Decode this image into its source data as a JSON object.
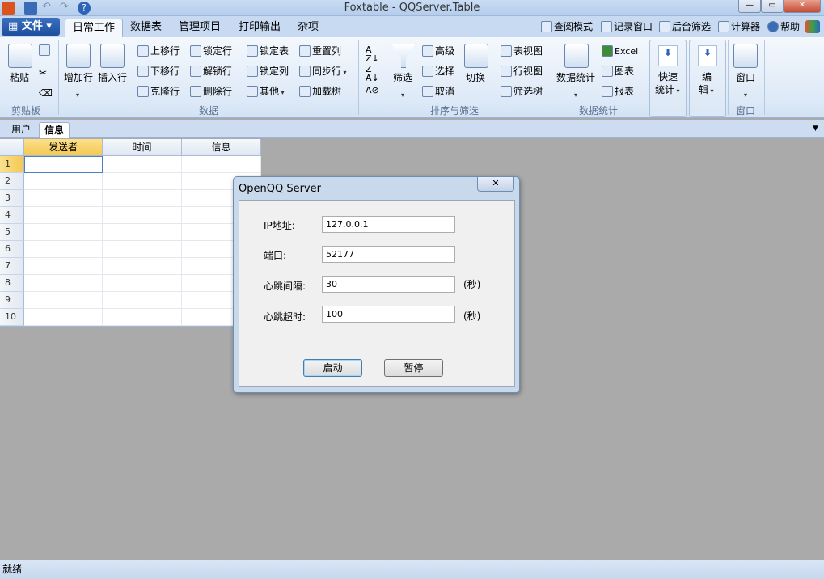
{
  "window": {
    "title": "Foxtable - QQServer.Table"
  },
  "menu": {
    "file": "文件",
    "tabs": [
      "日常工作",
      "数据表",
      "管理项目",
      "打印输出",
      "杂项"
    ]
  },
  "right_tools": [
    "查阅模式",
    "记录窗口",
    "后台筛选",
    "计算器",
    "帮助"
  ],
  "ribbon": {
    "clipboard": {
      "paste": "粘贴",
      "group": "剪贴板"
    },
    "data": {
      "add_row": "增加行",
      "insert_row": "插入行",
      "move_up": "上移行",
      "move_down": "下移行",
      "clone_row": "克隆行",
      "lock_row": "锁定行",
      "unlock_row": "解锁行",
      "delete_row": "删除行",
      "lock_table": "锁定表",
      "lock_col": "锁定列",
      "other": "其他",
      "reset_col": "重置列",
      "sync_row": "同步行",
      "load_tree": "加载树",
      "group": "数据"
    },
    "sort": {
      "filter": "筛选",
      "advanced": "高级",
      "select": "选择",
      "cancel": "取消",
      "switch": "切换",
      "table_view": "表视图",
      "row_view": "行视图",
      "filter_tree": "筛选树",
      "group": "排序与筛选"
    },
    "stats": {
      "data_stats": "数据统计",
      "excel": "Excel",
      "chart": "图表",
      "report": "报表",
      "group": "数据统计"
    },
    "quick": {
      "line1": "快速",
      "line2": "统计"
    },
    "edit": {
      "line1": "编",
      "line2": "辑"
    },
    "window": {
      "label": "窗口",
      "group": "窗口"
    }
  },
  "sheets": [
    "用户",
    "信息"
  ],
  "grid": {
    "columns": [
      "发送者",
      "时间",
      "信息"
    ],
    "rows": [
      "1",
      "2",
      "3",
      "4",
      "5",
      "6",
      "7",
      "8",
      "9",
      "10"
    ]
  },
  "dialog": {
    "title": "OpenQQ Server",
    "close": "✕",
    "ip_label": "IP地址:",
    "ip_value": "127.0.0.1",
    "port_label": "端口:",
    "port_value": "52177",
    "hb_interval_label": "心跳间隔:",
    "hb_interval_value": "30",
    "hb_timeout_label": "心跳超时:",
    "hb_timeout_value": "100",
    "unit": "(秒)",
    "start": "启动",
    "pause": "暂停"
  },
  "status": {
    "text": "就绪"
  }
}
